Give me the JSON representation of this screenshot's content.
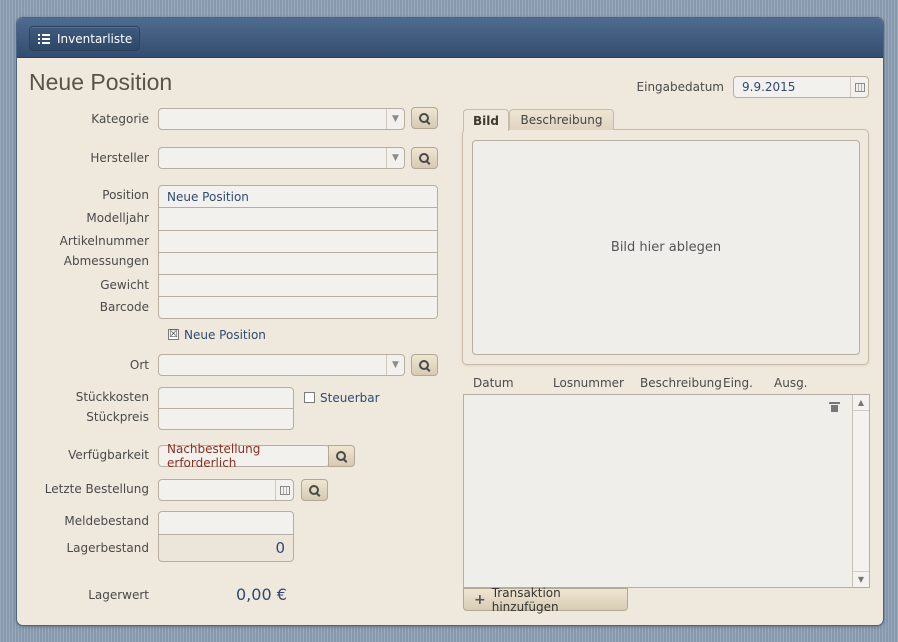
{
  "toolbar": {
    "nav_button_label": "Inventarliste",
    "nav_icon": "list-icon"
  },
  "page_title": "Neue Position",
  "date": {
    "label": "Eingabedatum",
    "value": "9.9.2015"
  },
  "form": {
    "kategorie_label": "Kategorie",
    "hersteller_label": "Hersteller",
    "position_label": "Position",
    "position_value": "Neue Position",
    "modelljahr_label": "Modelljahr",
    "artikelnummer_label": "Artikelnummer",
    "abmessungen_label": "Abmessungen",
    "gewicht_label": "Gewicht",
    "barcode_label": "Barcode",
    "neue_position_checkbox_label": "Neue Position",
    "neue_position_checked": "☒",
    "ort_label": "Ort",
    "stueckkosten_label": "Stückkosten",
    "stueckpreis_label": "Stückpreis",
    "steuerbar_label": "Steuerbar",
    "verfuegbarkeit_label": "Verfügbarkeit",
    "verfuegbarkeit_value": "Nachbestellung erforderlich",
    "letzte_bestellung_label": "Letzte Bestellung",
    "meldebestand_label": "Meldebestand",
    "lagerbestand_label": "Lagerbestand",
    "lagerbestand_value": "0",
    "lagerwert_label": "Lagerwert",
    "lagerwert_value": "0,00 €"
  },
  "tabs": [
    {
      "label": "Bild",
      "active": true
    },
    {
      "label": "Beschreibung",
      "active": false
    }
  ],
  "image_drop_text": "Bild hier ablegen",
  "transactions": {
    "columns": [
      "Datum",
      "Losnummer",
      "Beschreibung",
      "Eing.",
      "Ausg."
    ],
    "add_button_label": "Transaktion hinzufügen"
  },
  "colors": {
    "accent": "#3e5a7e",
    "field_text": "#2f4a72",
    "availability_text": "#8b2f1f",
    "background": "#efe8dc"
  }
}
